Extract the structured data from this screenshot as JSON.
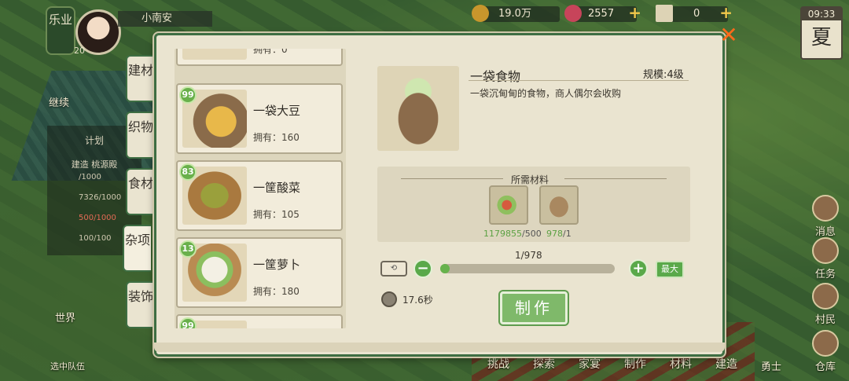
{
  "hud": {
    "realm_label": "乐业",
    "player_level": "20",
    "player_name": "小南安",
    "money": "19.0万",
    "gems": "2557",
    "tickets": "0",
    "time": "09:33",
    "season": "夏"
  },
  "left_hud": {
    "continue": "继续",
    "plan_title": "计划",
    "plan_sub": "建造 桃源殿",
    "plan_rows": [
      "/1000",
      "7326/1000",
      "500/1000",
      "100/100"
    ],
    "world": "世界",
    "team": "选中队伍"
  },
  "right_hud": {
    "message": "消息",
    "task": "任务",
    "villager": "村民",
    "warehouse": "仓库",
    "hero": "勇士"
  },
  "bottom_nav": [
    "挑战",
    "探索",
    "家宴",
    "制作",
    "材料",
    "建造"
  ],
  "tabs": [
    "建材",
    "织物",
    "食材",
    "杂项",
    "装饰"
  ],
  "list": {
    "items": [
      {
        "level": "",
        "name": "",
        "own": "拥有：0"
      },
      {
        "level": "99",
        "name": "一袋大豆",
        "own": "拥有：160"
      },
      {
        "level": "83",
        "name": "一筐酸菜",
        "own": "拥有：105"
      },
      {
        "level": "13",
        "name": "一筐萝卜",
        "own": "拥有：180"
      },
      {
        "level": "99",
        "name": "",
        "own": ""
      }
    ]
  },
  "detail": {
    "name": "一袋食物",
    "scale": "规模:4级",
    "description": "一袋沉甸甸的食物，商人偶尔会收购",
    "materials_title": "所需材料",
    "materials": [
      {
        "have": "1179855",
        "need": "/500"
      },
      {
        "have": "978",
        "need": "/1"
      }
    ],
    "quantity": "1/978",
    "quantity_fraction": 0.001,
    "max_label": "最大",
    "time": "17.6秒",
    "make_label": "制作"
  },
  "colors": {
    "accent_green": "#5aa94a",
    "dialog_bg": "#eae4d0",
    "close_orange": "#ff6a1a"
  }
}
